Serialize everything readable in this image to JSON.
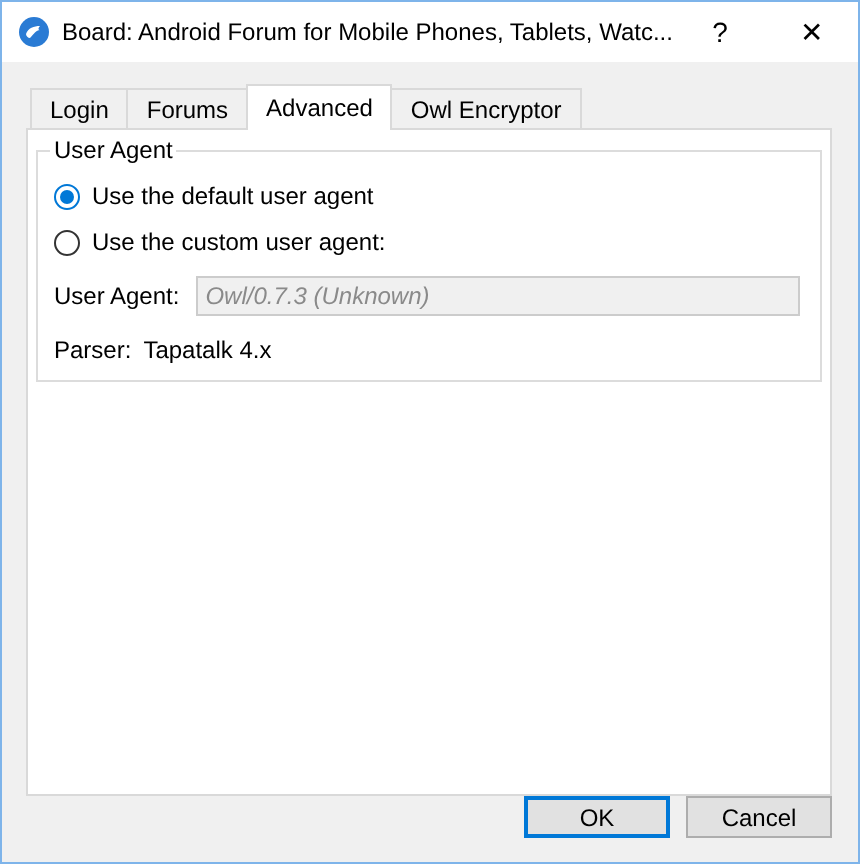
{
  "window": {
    "title": "Board: Android Forum for Mobile Phones, Tablets, Watc...",
    "help": "?",
    "close": "✕"
  },
  "tabs": [
    {
      "label": "Login",
      "selected": false
    },
    {
      "label": "Forums",
      "selected": false
    },
    {
      "label": "Advanced",
      "selected": true
    },
    {
      "label": "Owl Encryptor",
      "selected": false
    }
  ],
  "group": {
    "title": "User Agent",
    "options": [
      {
        "label": "Use the default user agent",
        "selected": true
      },
      {
        "label": "Use the custom user agent:",
        "selected": false
      }
    ],
    "field": {
      "label": "User Agent:",
      "placeholder": "Owl/0.7.3 (Unknown)",
      "disabled": true
    },
    "parser": {
      "label": "Parser:",
      "value": "Tapatalk 4.x"
    }
  },
  "buttons": [
    {
      "label": "OK",
      "default": true
    },
    {
      "label": "Cancel",
      "default": false
    }
  ]
}
